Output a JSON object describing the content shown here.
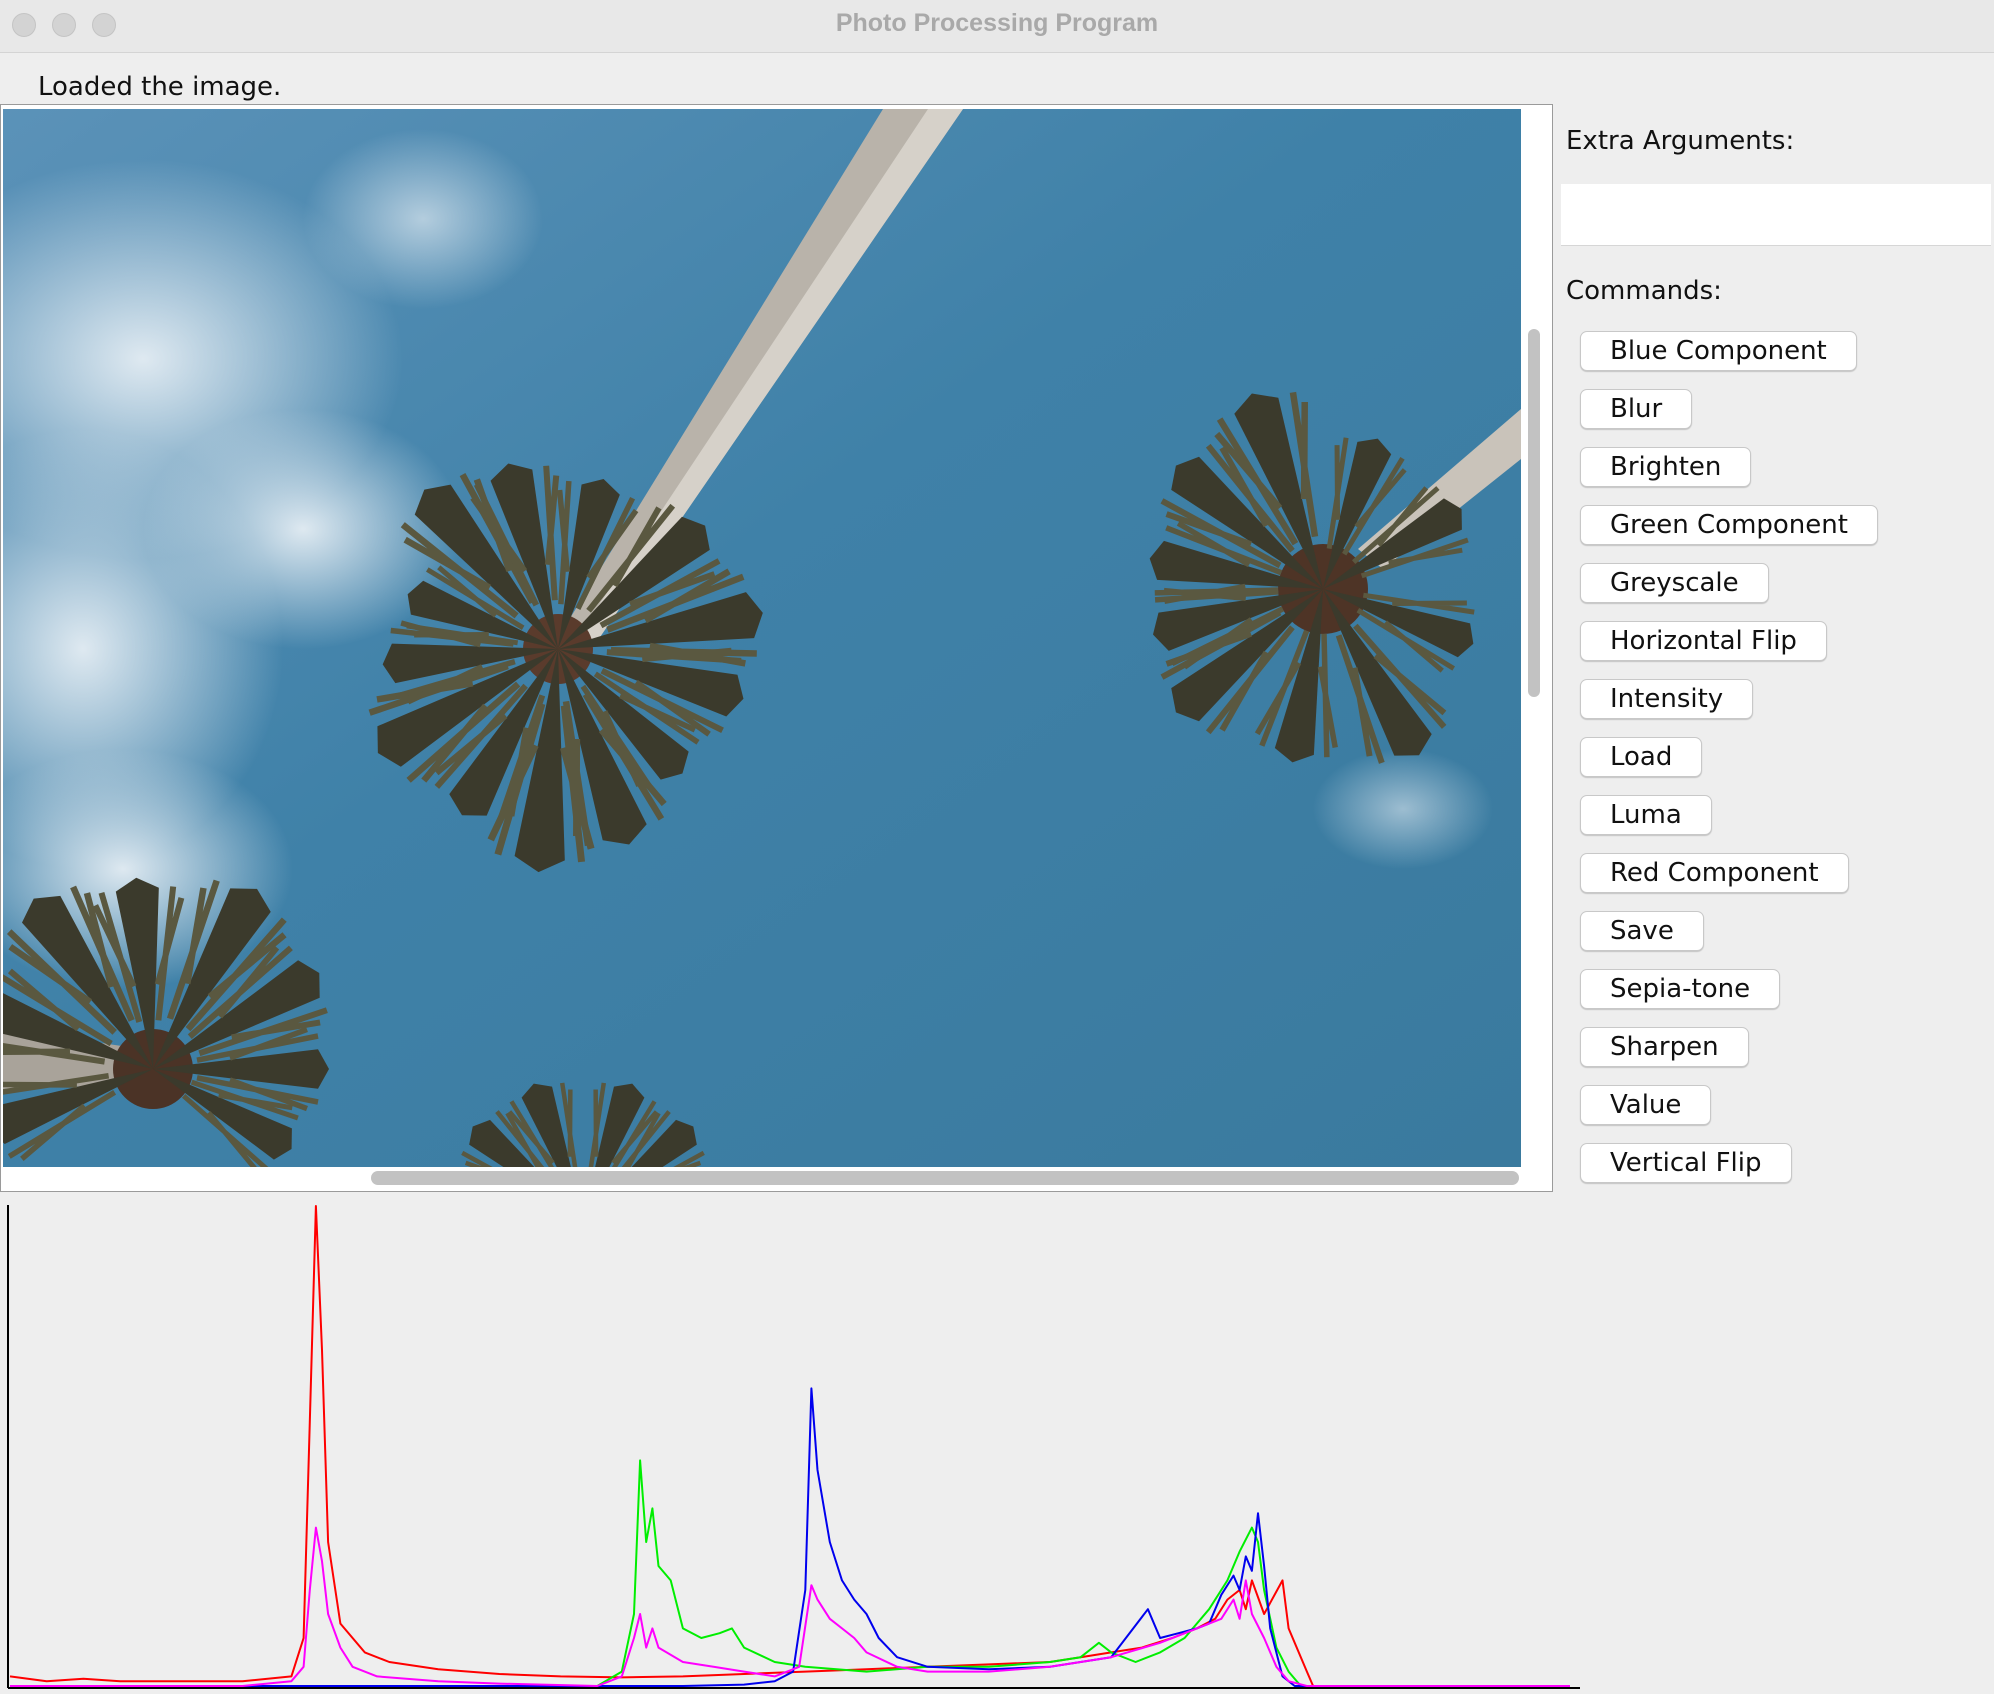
{
  "window": {
    "title": "Photo Processing Program"
  },
  "status": {
    "message": "Loaded the image."
  },
  "image_view": {
    "description_icon": "palm-trees-photo",
    "sky_color": "#3c7ea5"
  },
  "side_panel": {
    "extra_args_label": "Extra Arguments:",
    "extra_args_value": "",
    "commands_label": "Commands:",
    "commands": [
      "Blue Component",
      "Blur",
      "Brighten",
      "Green Component",
      "Greyscale",
      "Horizontal Flip",
      "Intensity",
      "Load",
      "Luma",
      "Red Component",
      "Save",
      "Sepia-tone",
      "Sharpen",
      "Value",
      "Vertical Flip"
    ]
  },
  "chart_data": {
    "type": "line",
    "title": "",
    "xlabel": "",
    "ylabel": "",
    "xlim": [
      0,
      255
    ],
    "ylim": [
      0,
      100
    ],
    "grid": false,
    "series": [
      {
        "color": "#ff0000",
        "points": [
          [
            0,
            2
          ],
          [
            6,
            1
          ],
          [
            12,
            1.5
          ],
          [
            18,
            1
          ],
          [
            25,
            1
          ],
          [
            38,
            1
          ],
          [
            46,
            2
          ],
          [
            48,
            10
          ],
          [
            49,
            55
          ],
          [
            50,
            100
          ],
          [
            51,
            70
          ],
          [
            52,
            30
          ],
          [
            54,
            13
          ],
          [
            58,
            7
          ],
          [
            62,
            5
          ],
          [
            70,
            3.5
          ],
          [
            80,
            2.5
          ],
          [
            90,
            2
          ],
          [
            100,
            1.8
          ],
          [
            110,
            2
          ],
          [
            120,
            2.5
          ],
          [
            130,
            3
          ],
          [
            140,
            3.5
          ],
          [
            150,
            4
          ],
          [
            160,
            4.5
          ],
          [
            170,
            5
          ],
          [
            175,
            6
          ],
          [
            180,
            7
          ],
          [
            185,
            8
          ],
          [
            190,
            10
          ],
          [
            194,
            12
          ],
          [
            197,
            14
          ],
          [
            199,
            18
          ],
          [
            201,
            20
          ],
          [
            202,
            16
          ],
          [
            203,
            22
          ],
          [
            205,
            15
          ],
          [
            208,
            22
          ],
          [
            209,
            12
          ],
          [
            212,
            3
          ],
          [
            213,
            0
          ],
          [
            255,
            0
          ]
        ]
      },
      {
        "color": "#00ee00",
        "points": [
          [
            0,
            0
          ],
          [
            96,
            0
          ],
          [
            100,
            3
          ],
          [
            102,
            15
          ],
          [
            103,
            47
          ],
          [
            104,
            30
          ],
          [
            105,
            37
          ],
          [
            106,
            25
          ],
          [
            108,
            22
          ],
          [
            110,
            12
          ],
          [
            113,
            10
          ],
          [
            116,
            11
          ],
          [
            118,
            12
          ],
          [
            120,
            8
          ],
          [
            125,
            5
          ],
          [
            130,
            4
          ],
          [
            140,
            3
          ],
          [
            150,
            4
          ],
          [
            160,
            4
          ],
          [
            170,
            5
          ],
          [
            175,
            6
          ],
          [
            178,
            9
          ],
          [
            180,
            7
          ],
          [
            184,
            5
          ],
          [
            188,
            7
          ],
          [
            192,
            10
          ],
          [
            196,
            16
          ],
          [
            199,
            22
          ],
          [
            201,
            28
          ],
          [
            203,
            33
          ],
          [
            204,
            30
          ],
          [
            205,
            20
          ],
          [
            207,
            8
          ],
          [
            209,
            3
          ],
          [
            211,
            0
          ],
          [
            255,
            0
          ]
        ]
      },
      {
        "color": "#0000ee",
        "points": [
          [
            0,
            0
          ],
          [
            110,
            0
          ],
          [
            120,
            0.3
          ],
          [
            125,
            1
          ],
          [
            128,
            3
          ],
          [
            130,
            20
          ],
          [
            131,
            62
          ],
          [
            132,
            45
          ],
          [
            134,
            30
          ],
          [
            136,
            22
          ],
          [
            138,
            18
          ],
          [
            140,
            15
          ],
          [
            142,
            10
          ],
          [
            145,
            6
          ],
          [
            150,
            4
          ],
          [
            160,
            3.5
          ],
          [
            170,
            4
          ],
          [
            180,
            6
          ],
          [
            186,
            16
          ],
          [
            188,
            10
          ],
          [
            191,
            11
          ],
          [
            194,
            12
          ],
          [
            196,
            13
          ],
          [
            198,
            19
          ],
          [
            200,
            23
          ],
          [
            201,
            20
          ],
          [
            202,
            27
          ],
          [
            203,
            24
          ],
          [
            204,
            36
          ],
          [
            205,
            25
          ],
          [
            206,
            12
          ],
          [
            208,
            2
          ],
          [
            210,
            0
          ],
          [
            255,
            0
          ]
        ]
      },
      {
        "color": "#ff00ff",
        "points": [
          [
            0,
            0
          ],
          [
            38,
            0
          ],
          [
            46,
            1
          ],
          [
            48,
            4
          ],
          [
            49,
            20
          ],
          [
            50,
            33
          ],
          [
            51,
            26
          ],
          [
            52,
            15
          ],
          [
            54,
            8
          ],
          [
            56,
            4
          ],
          [
            60,
            2
          ],
          [
            70,
            1
          ],
          [
            80,
            0.5
          ],
          [
            96,
            0
          ],
          [
            100,
            2
          ],
          [
            102,
            10
          ],
          [
            103,
            15
          ],
          [
            104,
            8
          ],
          [
            105,
            12
          ],
          [
            106,
            8
          ],
          [
            110,
            5
          ],
          [
            115,
            4
          ],
          [
            120,
            3
          ],
          [
            125,
            2
          ],
          [
            129,
            4
          ],
          [
            131,
            21
          ],
          [
            132,
            18
          ],
          [
            134,
            14
          ],
          [
            136,
            12
          ],
          [
            138,
            10
          ],
          [
            140,
            7
          ],
          [
            145,
            4
          ],
          [
            150,
            3
          ],
          [
            160,
            3
          ],
          [
            170,
            4
          ],
          [
            180,
            6
          ],
          [
            188,
            9
          ],
          [
            194,
            12
          ],
          [
            198,
            14
          ],
          [
            200,
            18
          ],
          [
            201,
            14
          ],
          [
            202,
            22
          ],
          [
            203,
            15
          ],
          [
            205,
            10
          ],
          [
            207,
            4
          ],
          [
            209,
            1
          ],
          [
            212,
            0
          ],
          [
            255,
            0
          ]
        ]
      }
    ]
  }
}
